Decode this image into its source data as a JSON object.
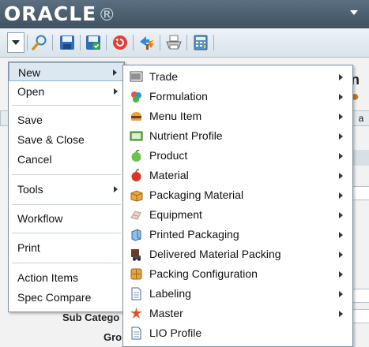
{
  "header": {
    "logo": "ORACLE",
    "logo_mark": "®"
  },
  "toolbar": {
    "icons": [
      "dropdown-arrow",
      "search-icon",
      "save-icon",
      "save-close-icon",
      "cancel-icon",
      "workflow-icon",
      "print-icon",
      "calculator-icon"
    ]
  },
  "background": {
    "title_fragment": "n",
    "tab_fragment": "a",
    "sub_category_label": "Sub Catego",
    "group_label": "Gro"
  },
  "menu": {
    "items": [
      {
        "label": "New",
        "submenu": true,
        "selected": true
      },
      {
        "label": "Open",
        "submenu": true
      },
      {
        "label": "Save"
      },
      {
        "label": "Save & Close"
      },
      {
        "label": "Cancel"
      },
      {
        "label": "Tools",
        "submenu": true
      },
      {
        "label": "Workflow"
      },
      {
        "label": "Print"
      },
      {
        "label": "Action Items"
      },
      {
        "label": "Spec Compare"
      }
    ]
  },
  "submenu": {
    "items": [
      {
        "label": "Trade",
        "icon": "trade-icon"
      },
      {
        "label": "Formulation",
        "icon": "formulation-icon"
      },
      {
        "label": "Menu Item",
        "icon": "menu-item-icon"
      },
      {
        "label": "Nutrient Profile",
        "icon": "nutrient-profile-icon"
      },
      {
        "label": "Product",
        "icon": "product-icon"
      },
      {
        "label": "Material",
        "icon": "material-icon"
      },
      {
        "label": "Packaging Material",
        "icon": "packaging-material-icon"
      },
      {
        "label": "Equipment",
        "icon": "equipment-icon"
      },
      {
        "label": "Printed Packaging",
        "icon": "printed-packaging-icon"
      },
      {
        "label": "Delivered Material Packing",
        "icon": "delivered-material-packing-icon"
      },
      {
        "label": "Packing Configuration",
        "icon": "packing-configuration-icon"
      },
      {
        "label": "Labeling",
        "icon": "labeling-icon"
      },
      {
        "label": "Master",
        "icon": "master-icon"
      },
      {
        "label": "LIO Profile",
        "icon": "lio-profile-icon"
      }
    ]
  }
}
